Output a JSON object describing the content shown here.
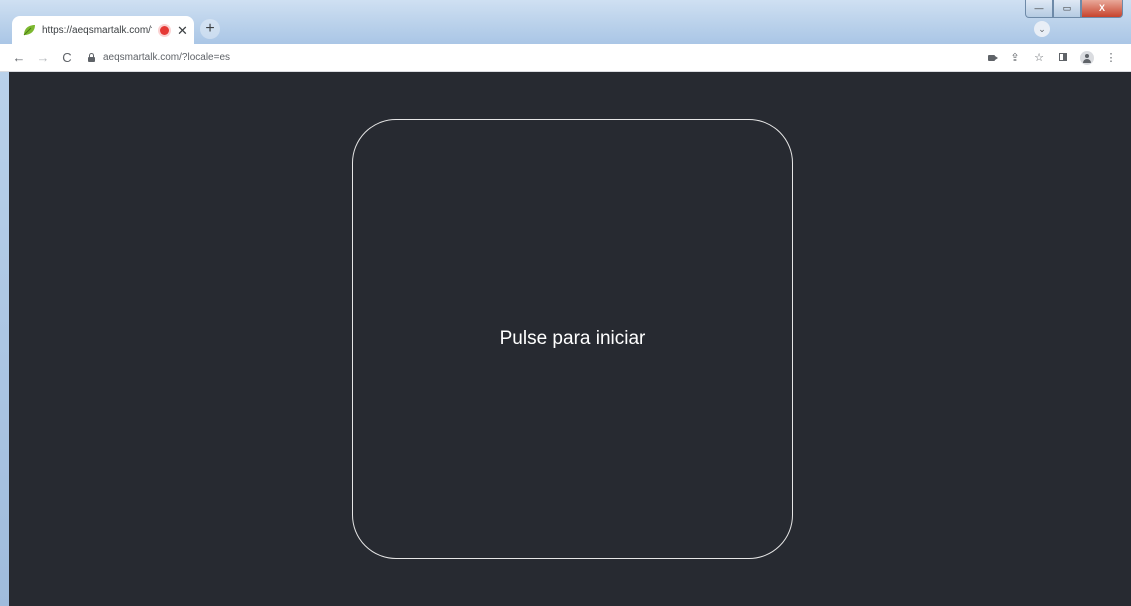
{
  "browser": {
    "tab": {
      "title": "https://aeqsmartalk.com/?l",
      "close_glyph": "✕",
      "favicon": "leaf-icon",
      "recording_indicator_color": "#e53935"
    },
    "new_tab_glyph": "+",
    "tab_search_glyph": "⌄",
    "window_controls": {
      "minimize": "—",
      "maximize": "▭",
      "close": "X"
    },
    "toolbar": {
      "back_glyph": "←",
      "forward_glyph": "→",
      "reload_glyph": "C",
      "url": "aeqsmartalk.com/?locale=es",
      "share_glyph": "⇪",
      "bookmark_glyph": "☆",
      "menu_glyph": "⋮"
    }
  },
  "main": {
    "start_label": "Pulse para iniciar",
    "background_color": "#272a31",
    "border_color": "#e6e6e6"
  }
}
